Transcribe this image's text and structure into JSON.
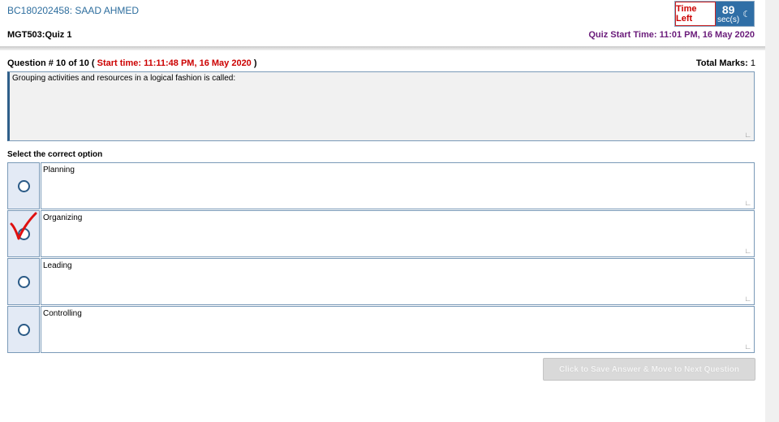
{
  "header": {
    "student_id": "BC180202458: SAAD AHMED",
    "course": "MGT503:Quiz 1",
    "quiz_start": "Quiz Start Time: 11:01 PM, 16 May 2020",
    "timer": {
      "label": "Time Left",
      "value": "89",
      "unit": "sec(s)",
      "icon": "moon-icon"
    }
  },
  "question": {
    "header_prefix": "Question # 10 of 10 ( ",
    "start_time": "Start time: 11:11:48 PM, 16 May 2020",
    "header_suffix": " )",
    "total_marks_label": "Total Marks:",
    "total_marks_value": "1",
    "text": "Grouping activities and resources in a logical fashion is called:"
  },
  "select_label": "Select the correct option",
  "options": [
    {
      "label": "Planning",
      "marked": false
    },
    {
      "label": "Organizing",
      "marked": true
    },
    {
      "label": "Leading",
      "marked": false
    },
    {
      "label": "Controlling",
      "marked": false
    }
  ],
  "next_button": "Click to Save Answer & Move to Next Question",
  "colors": {
    "accent_blue": "#2f6ea6",
    "timer_red": "#cc0000",
    "check_red": "#e01010"
  }
}
